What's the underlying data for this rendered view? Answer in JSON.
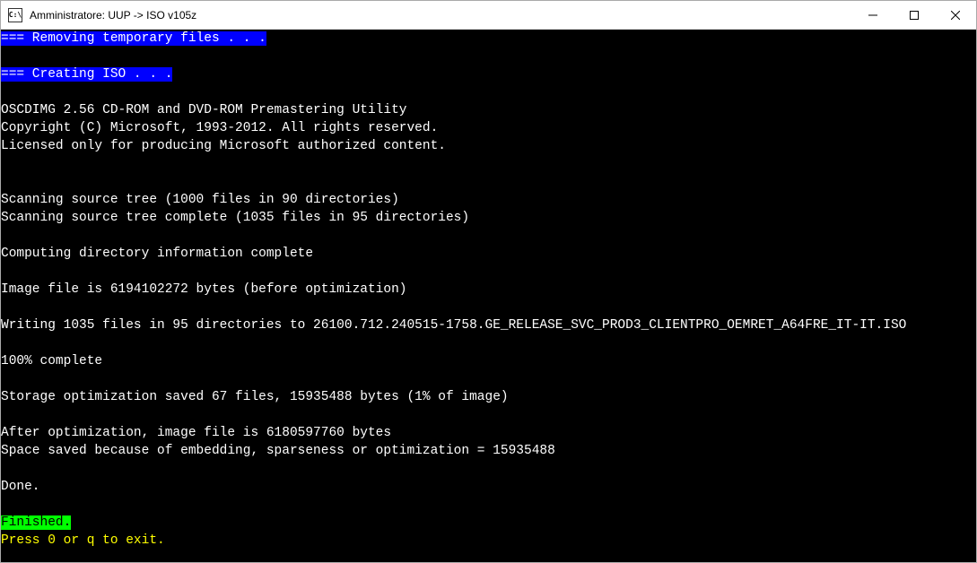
{
  "window": {
    "title": "Amministratore:  UUP -> ISO v105z"
  },
  "terminal": {
    "step1": "=== Removing temporary files . . .",
    "step2": "=== Creating ISO . . .",
    "oscdimg1": "OSCDIMG 2.56 CD-ROM and DVD-ROM Premastering Utility",
    "oscdimg2": "Copyright (C) Microsoft, 1993-2012. All rights reserved.",
    "oscdimg3": "Licensed only for producing Microsoft authorized content.",
    "scan1": "Scanning source tree (1000 files in 90 directories)",
    "scan2": "Scanning source tree complete (1035 files in 95 directories)",
    "compute": "Computing directory information complete",
    "imagefile": "Image file is 6194102272 bytes (before optimization)",
    "writing": "Writing 1035 files in 95 directories to 26100.712.240515-1758.GE_RELEASE_SVC_PROD3_CLIENTPRO_OEMRET_A64FRE_IT-IT.ISO",
    "progress": "100% complete",
    "storage": "Storage optimization saved 67 files, 15935488 bytes (1% of image)",
    "after1": "After optimization, image file is 6180597760 bytes",
    "after2": "Space saved because of embedding, sparseness or optimization = 15935488",
    "done": "Done.",
    "finished": "Finished.",
    "exit": "Press 0 or q to exit."
  }
}
